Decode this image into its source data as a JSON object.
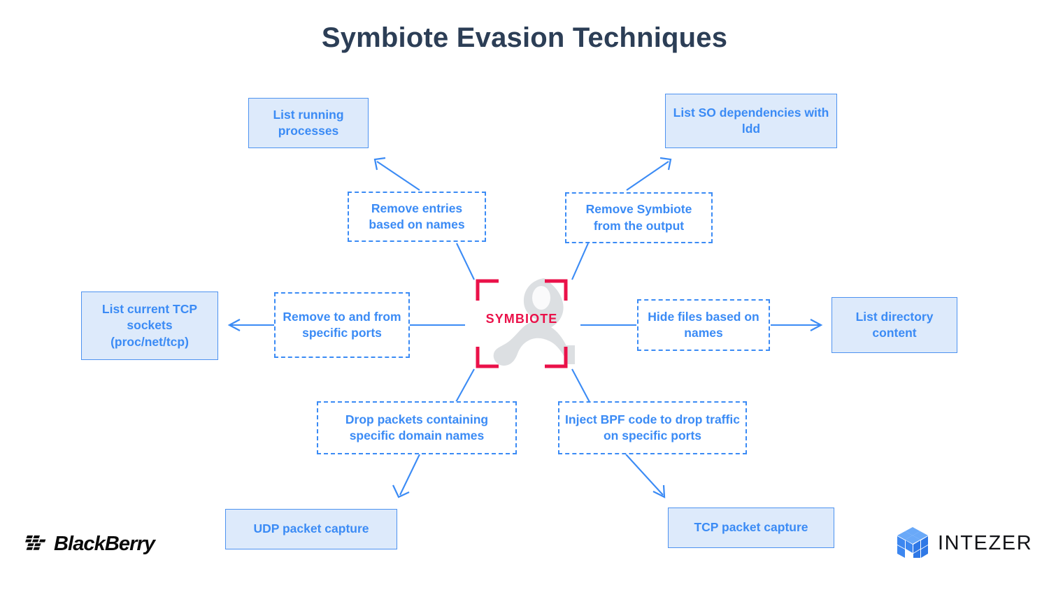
{
  "title": "Symbiote Evasion Techniques",
  "center": {
    "label": "SYMBIOTE",
    "icon": "gecko-silhouette",
    "bracket_color": "#ea1149"
  },
  "colors": {
    "title": "#2c3e56",
    "node_text": "#3b8bf5",
    "node_fill": "#ddeafb",
    "node_border": "#4d92f0",
    "connector": "#3b8bf5",
    "accent_pink": "#ea1149",
    "background": "#ffffff"
  },
  "nodes": {
    "outcomes": [
      {
        "id": "list-running-processes",
        "label": "List running processes"
      },
      {
        "id": "list-so-dependencies",
        "label": "List SO dependencies with ldd"
      },
      {
        "id": "list-current-tcp-sockets",
        "label": "List current TCP sockets (proc/net/tcp)"
      },
      {
        "id": "list-directory-content",
        "label": "List directory content"
      },
      {
        "id": "udp-packet-capture",
        "label": "UDP packet capture"
      },
      {
        "id": "tcp-packet-capture",
        "label": "TCP packet capture"
      }
    ],
    "techniques": [
      {
        "id": "remove-entries-based-on-names",
        "label": "Remove entries based on names"
      },
      {
        "id": "remove-symbiote-from-the-output",
        "label": "Remove Symbiote from the output"
      },
      {
        "id": "remove-to-and-from-specific-ports",
        "label": "Remove to and from specific ports"
      },
      {
        "id": "hide-files-based-on-names",
        "label": "Hide files based on names"
      },
      {
        "id": "drop-packets-domain-names",
        "label": "Drop packets containing specific domain names"
      },
      {
        "id": "inject-bpf-code",
        "label": "Inject BPF code to drop traffic on specific ports"
      }
    ]
  },
  "footer": {
    "blackberry": {
      "word": "BlackBerry",
      "icon": "blackberry-dots-logo"
    },
    "intezer": {
      "word": "INTEZER",
      "icon": "intezer-cube-logo"
    }
  },
  "chart_data": {
    "type": "diagram",
    "title": "Symbiote Evasion Techniques",
    "center_node": "SYMBIOTE",
    "edges": [
      {
        "from": "SYMBIOTE",
        "to": "Remove entries based on names",
        "arrow": false
      },
      {
        "from": "Remove entries based on names",
        "to": "List running processes",
        "arrow": true
      },
      {
        "from": "SYMBIOTE",
        "to": "Remove Symbiote from the output",
        "arrow": false
      },
      {
        "from": "Remove Symbiote from the output",
        "to": "List SO dependencies with ldd",
        "arrow": true
      },
      {
        "from": "SYMBIOTE",
        "to": "Remove to and from specific ports",
        "arrow": false
      },
      {
        "from": "Remove to and from specific ports",
        "to": "List current TCP sockets (proc/net/tcp)",
        "arrow": true
      },
      {
        "from": "SYMBIOTE",
        "to": "Hide files based on names",
        "arrow": false
      },
      {
        "from": "Hide files based on names",
        "to": "List directory content",
        "arrow": true
      },
      {
        "from": "SYMBIOTE",
        "to": "Drop packets containing specific domain names",
        "arrow": false
      },
      {
        "from": "Drop packets containing specific domain names",
        "to": "UDP packet capture",
        "arrow": true
      },
      {
        "from": "SYMBIOTE",
        "to": "Inject BPF code to drop traffic on specific ports",
        "arrow": false
      },
      {
        "from": "Inject BPF code to drop traffic on specific ports",
        "to": "TCP packet capture",
        "arrow": true
      }
    ]
  }
}
